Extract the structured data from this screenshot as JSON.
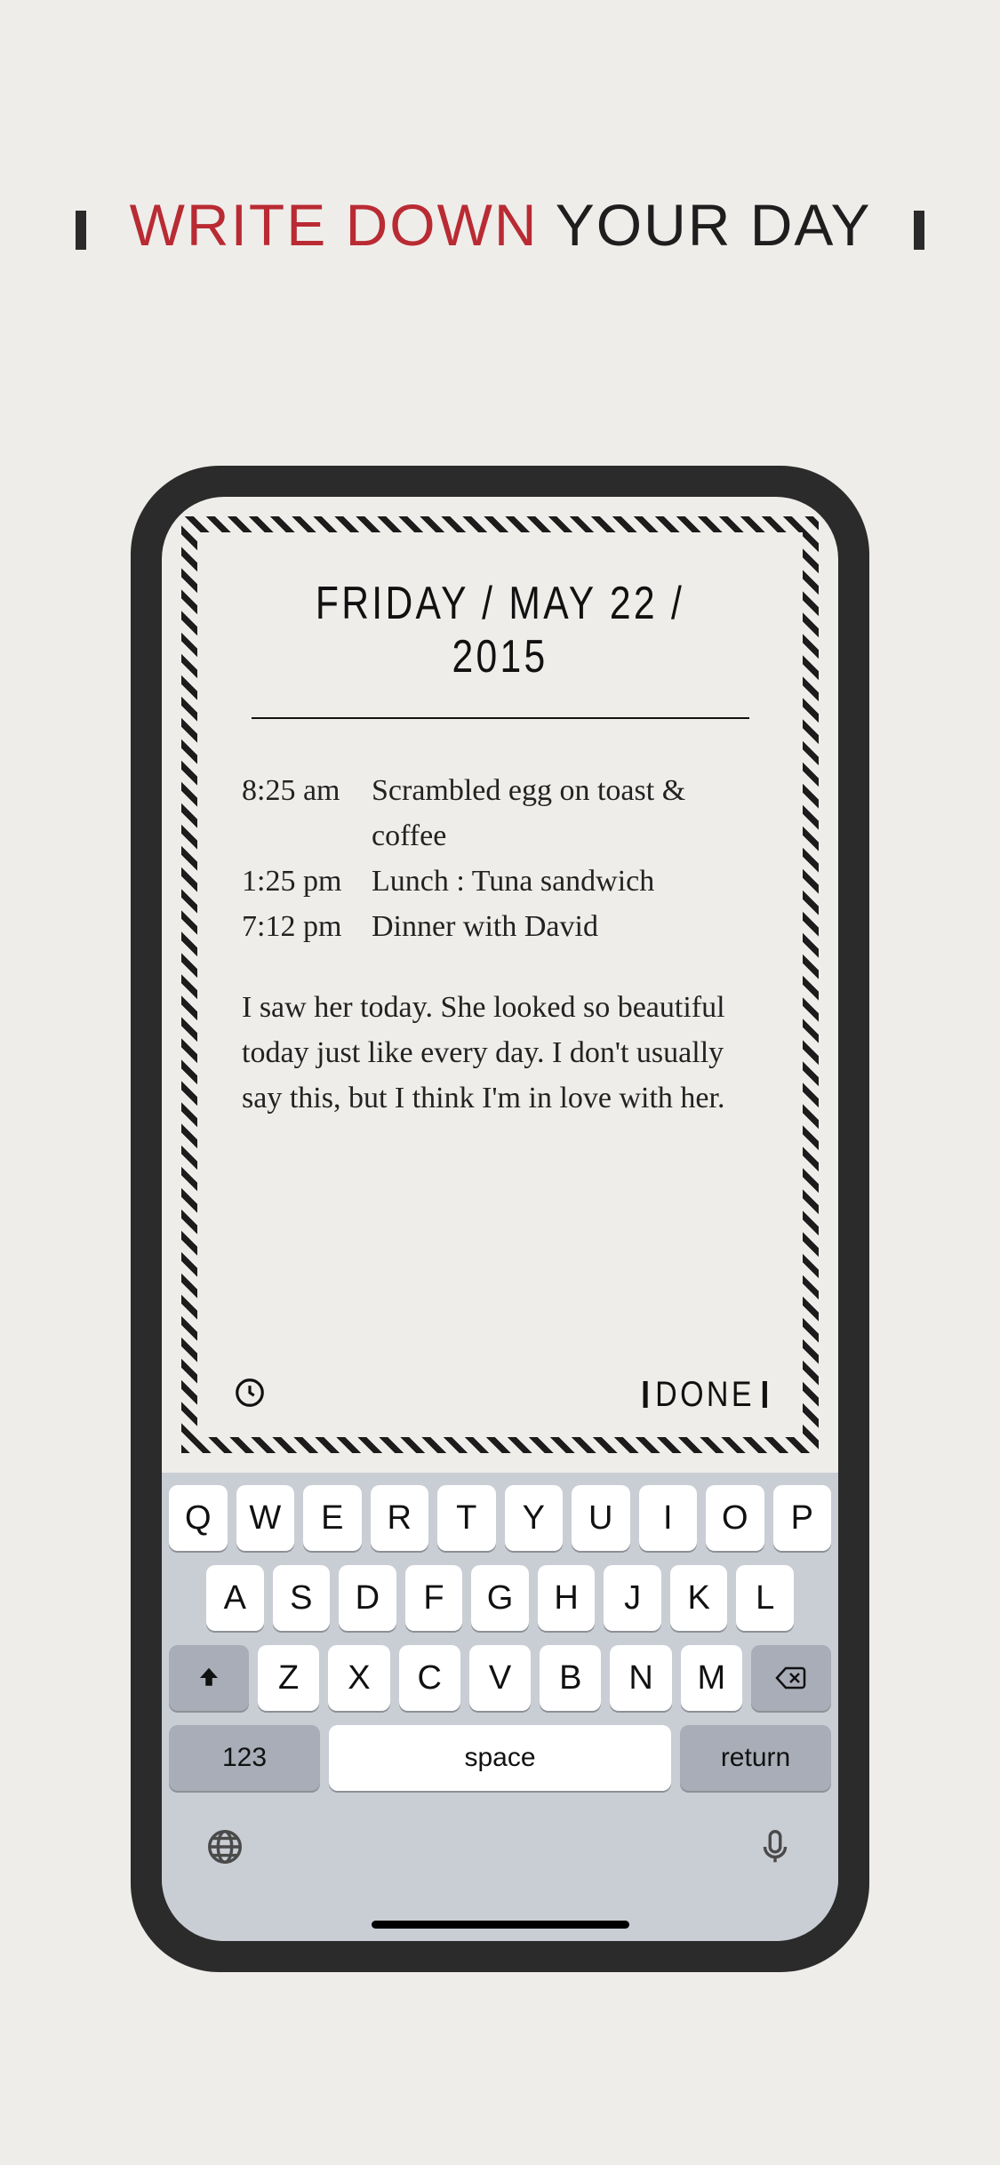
{
  "headline": {
    "red": "WRITE DOWN",
    "black": "YOUR DAY"
  },
  "note": {
    "date": "FRIDAY / MAY 22 / 2015",
    "entries": [
      {
        "time": "8:25 am",
        "text": "Scrambled egg on toast & coffee"
      },
      {
        "time": "1:25 pm",
        "text": "Lunch : Tuna sandwich"
      },
      {
        "time": "7:12 pm",
        "text": "Dinner with David"
      }
    ],
    "paragraph": "I saw her today. She looked so beautiful today just like every day. I don't usually say this, but I think I'm in love with her.",
    "done_label": "DONE"
  },
  "keyboard": {
    "row1": [
      "Q",
      "W",
      "E",
      "R",
      "T",
      "Y",
      "U",
      "I",
      "O",
      "P"
    ],
    "row2": [
      "A",
      "S",
      "D",
      "F",
      "G",
      "H",
      "J",
      "K",
      "L"
    ],
    "row3": [
      "Z",
      "X",
      "C",
      "V",
      "B",
      "N",
      "M"
    ],
    "num_label": "123",
    "space_label": "space",
    "return_label": "return"
  }
}
